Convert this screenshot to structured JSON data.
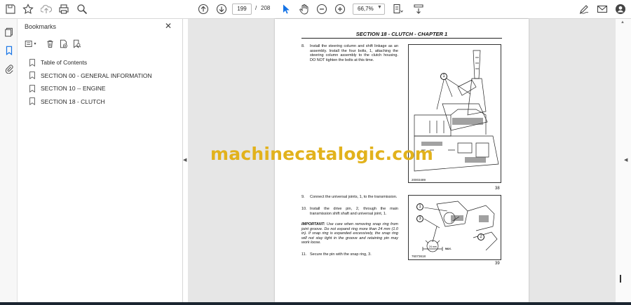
{
  "toolbar": {
    "page_current": "199",
    "page_separator": "/",
    "page_total": "208",
    "zoom": "66,7%",
    "icons": [
      "save-icon",
      "star-icon",
      "upload-icon",
      "print-icon",
      "zoom-search-icon",
      "page-up-icon",
      "page-down-icon",
      "cursor-icon",
      "hand-icon",
      "zoom-out-icon",
      "zoom-in-icon",
      "fit-page-icon",
      "scroll-mode-icon",
      "sign-icon",
      "email-icon",
      "account-icon"
    ]
  },
  "panel": {
    "title": "Bookmarks",
    "items": [
      {
        "label": "Table of Contents"
      },
      {
        "label": "SECTION 00 - GENERAL INFORMATION"
      },
      {
        "label": "SECTION 10 -- ENGINE"
      },
      {
        "label": "SECTION 18 - CLUTCH"
      }
    ]
  },
  "document": {
    "header": "SECTION 18 - CLUTCH - CHAPTER 1",
    "step8_num": "8.",
    "step8": "Install the steering column and shift linkage as an assembly. Install the four bolts, 1, attaching the steering column assembly to the clutch housing. DO NOT tighten the bolts at this time.",
    "fig38_code": "20003489",
    "fig38_num": "38",
    "step9_num": "9.",
    "step9": "Connect the universal joints, 1, to the transmission.",
    "step10_num": "10.",
    "step10": "Install the drive pin, 2, through the main transmission shift shaft and universal joint, 1.",
    "important_label": "IMPORTANT:",
    "important_text": "Use care when removing snap ring from joint groove. Do not expand ring more than 24 mm (1.0 in). If snap ring is expanded excessively, the snap ring will not stay tight in the groove and retaining pin may work loose.",
    "step11_num": "11.",
    "step11": "Secure the pin with the snap ring, 3.",
    "fig39_code": "76073618",
    "fig39_num": "39",
    "fig39_dim": "24 mm",
    "fig39_max": "MAX.",
    "callout_1": "1",
    "callout_2": "2",
    "callout_3": "3"
  },
  "watermark": "machinecatalogic.com",
  "colors": {
    "watermark": "#e2b21c",
    "viewport_bg": "#e6e6e6",
    "active_rail": "#1473e6"
  }
}
